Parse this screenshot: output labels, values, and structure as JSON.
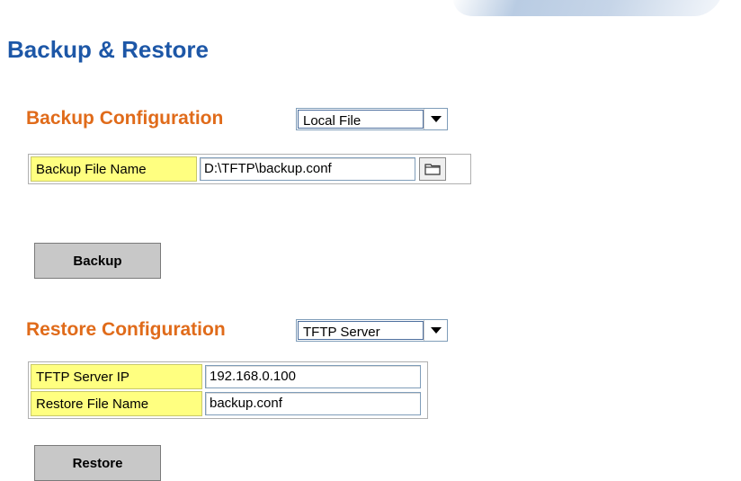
{
  "page": {
    "title": "Backup & Restore"
  },
  "backup": {
    "section_title": "Backup Configuration",
    "method_selected": "Local File",
    "file_name_label": "Backup File Name",
    "file_name_value": "D:\\TFTP\\backup.conf",
    "button_label": "Backup"
  },
  "restore": {
    "section_title": "Restore Configuration",
    "method_selected": "TFTP Server",
    "server_ip_label": "TFTP Server IP",
    "server_ip_value": "192.168.0.100",
    "file_name_label": "Restore File Name",
    "file_name_value": "backup.conf",
    "button_label": "Restore"
  },
  "colors": {
    "title": "#1d57a7",
    "section_title": "#e06b1a",
    "label_bg": "#ffff80",
    "button_bg": "#c8c8c8"
  },
  "icons": {
    "dropdown": "triangle-down-icon",
    "browse": "folder-icon"
  }
}
